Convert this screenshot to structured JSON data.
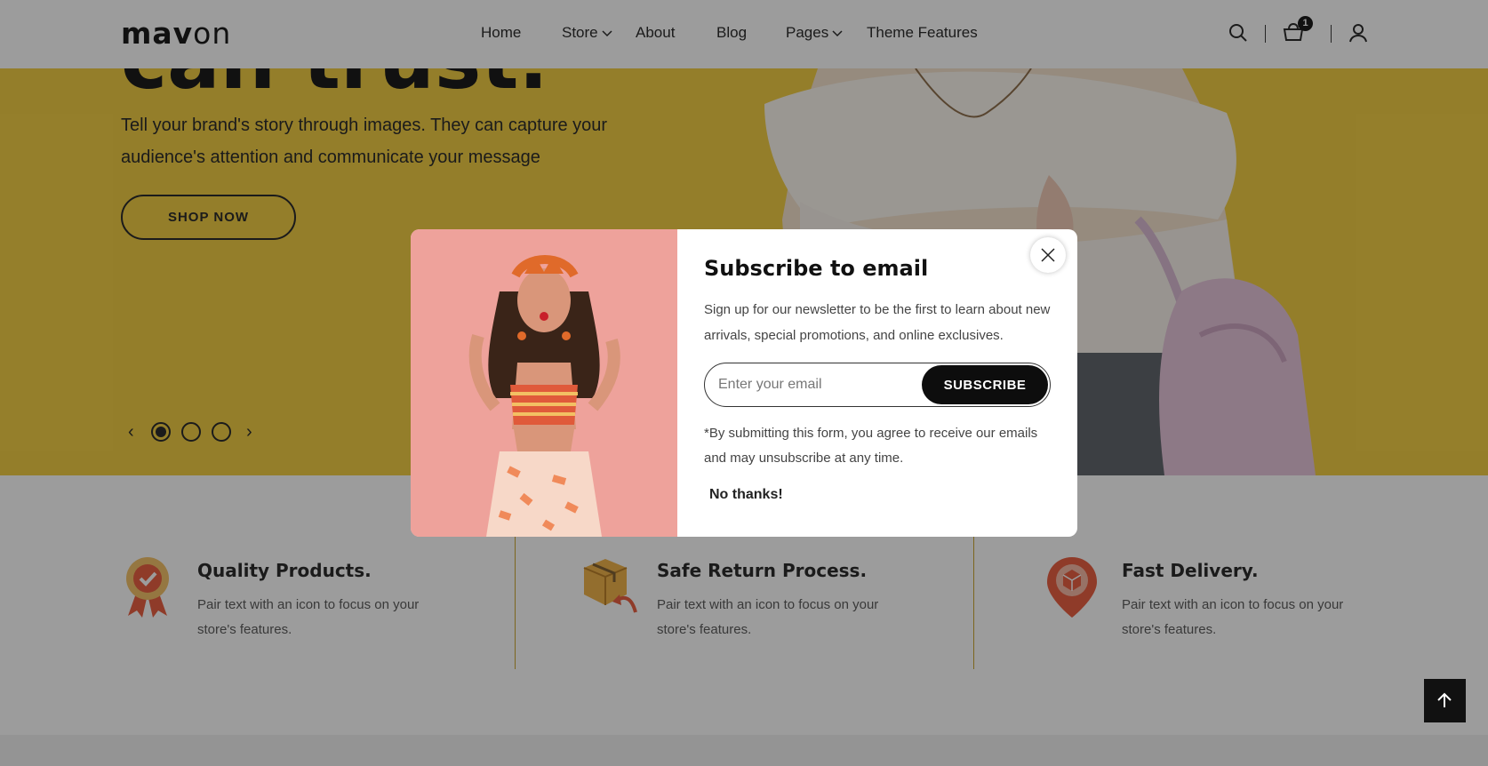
{
  "header": {
    "logo": {
      "bold": "mav",
      "thin": "on"
    },
    "nav": {
      "home": "Home",
      "store": "Store",
      "about": "About",
      "blog": "Blog",
      "pages": "Pages",
      "theme_features": "Theme Features"
    },
    "cart_count": "1",
    "icons": [
      "search-icon",
      "cart-icon",
      "account-icon"
    ]
  },
  "hero": {
    "title_fragment": "can trust.",
    "text": "Tell your brand's story through images. They can capture your audience's attention and communicate your message",
    "cta": "SHOP NOW",
    "slides": 3,
    "active_slide": 1,
    "background": "#f2cc3b"
  },
  "features": [
    {
      "title": "Quality Products.",
      "desc": "Pair text with an icon to focus on your store's features.",
      "icon": "award-badge-icon"
    },
    {
      "title": "Safe Return Process.",
      "desc": "Pair text with an icon to focus on your store's features.",
      "icon": "return-box-icon"
    },
    {
      "title": "Fast Delivery.",
      "desc": "Pair text with an icon to focus on your store's features.",
      "icon": "delivery-pin-icon"
    }
  ],
  "modal": {
    "title": "Subscribe to email",
    "desc": "Sign up for our newsletter to be the first to learn about new arrivals, special promotions, and online exclusives.",
    "email_placeholder": "Enter your email",
    "submit": "SUBSCRIBE",
    "note": "*By submitting this form, you agree to receive our emails and may unsubscribe at any time.",
    "dismiss": "No thanks!"
  },
  "colors": {
    "accent": "#f2cc3b",
    "dark": "#111111",
    "icon_orange": "#e8583a"
  }
}
